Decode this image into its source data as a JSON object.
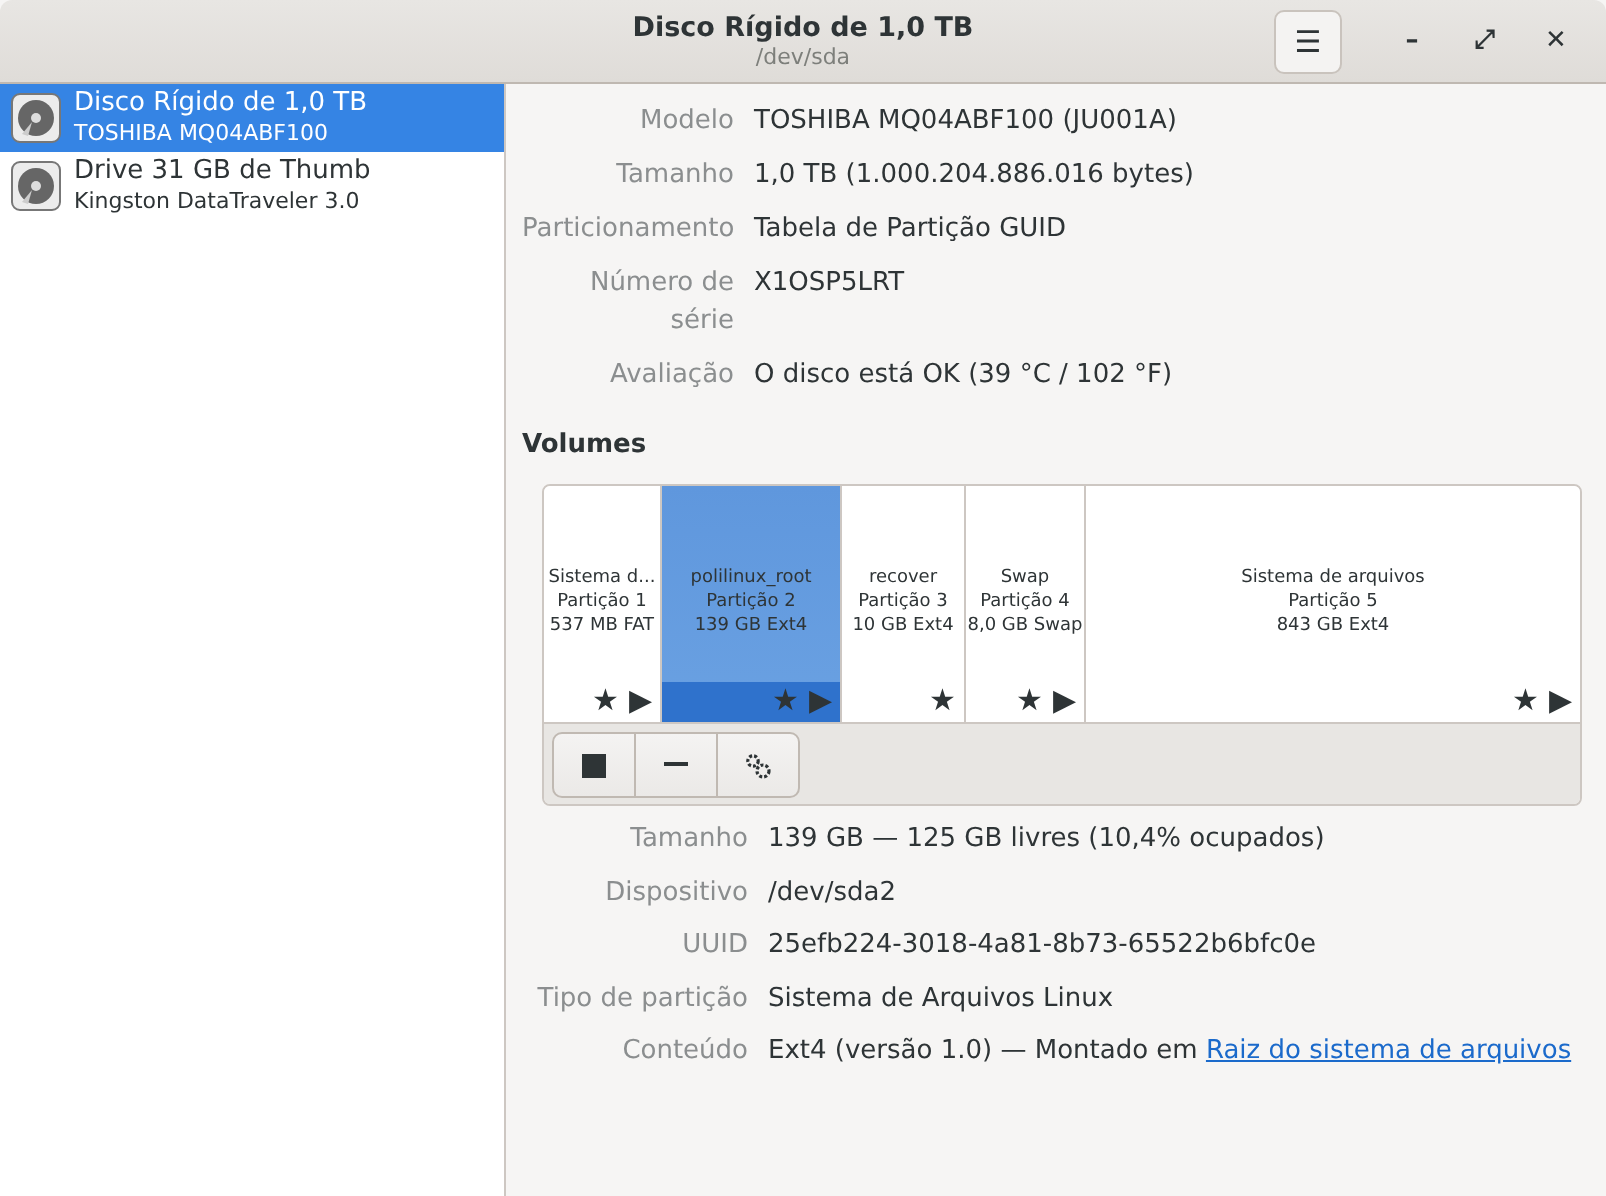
{
  "window": {
    "title": "Disco Rígido de 1,0 TB",
    "subtitle": "/dev/sda",
    "menu_button": "☰",
    "minimize": "–",
    "maximize": "⤢",
    "close": "✕"
  },
  "sidebar": {
    "items": [
      {
        "name": "Disco Rígido de 1,0 TB",
        "detail": "TOSHIBA MQ04ABF100",
        "selected": true
      },
      {
        "name": "Drive 31 GB de Thumb",
        "detail": "Kingston DataTraveler 3.0",
        "selected": false
      }
    ]
  },
  "drive_info": [
    {
      "label": "Modelo",
      "value": "TOSHIBA MQ04ABF100 (JU001A)"
    },
    {
      "label": "Tamanho",
      "value": "1,0 TB (1.000.204.886.016 bytes)"
    },
    {
      "label": "Particionamento",
      "value": "Tabela de Partição GUID"
    },
    {
      "label": "Número de série",
      "value": "X1OSP5LRT"
    },
    {
      "label": "Avaliação",
      "value": "O disco está OK (39 °C / 102 °F)"
    }
  ],
  "volumes": {
    "heading": "Volumes",
    "partitions": [
      {
        "name": "Sistema d...",
        "number": "Partição 1",
        "size": "537 MB FAT",
        "marks": [
          "★",
          "▶"
        ],
        "selected": false
      },
      {
        "name": "polilinux_root",
        "number": "Partição 2",
        "size": "139 GB Ext4",
        "marks": [
          "★",
          "▶"
        ],
        "selected": true
      },
      {
        "name": "recover",
        "number": "Partição 3",
        "size": "10 GB Ext4",
        "marks": [
          "★"
        ],
        "selected": false
      },
      {
        "name": "Swap",
        "number": "Partição 4",
        "size": "8,0 GB Swap",
        "marks": [
          "★",
          "▶"
        ],
        "selected": false
      },
      {
        "name": "Sistema de arquivos",
        "number": "Partição 5",
        "size": "843 GB Ext4",
        "marks": [
          "★",
          "▶"
        ],
        "selected": false
      }
    ],
    "toolbar": [
      {
        "kind": "stop"
      },
      {
        "kind": "remove"
      },
      {
        "kind": "settings"
      }
    ]
  },
  "volume_info": [
    {
      "label": "Tamanho",
      "value": "139 GB — 125 GB livres (10,4% ocupados)"
    },
    {
      "label": "Dispositivo",
      "value": "/dev/sda2"
    },
    {
      "label": "UUID",
      "value": "25efb224-3018-4a81-8b73-65522b6bfc0e"
    },
    {
      "label": "Tipo de partição",
      "value": "Sistema de Arquivos Linux"
    },
    {
      "label": "Conteúdo",
      "value": "Ext4 (versão 1.0) — Montado em ",
      "link": "Raiz do sistema de arquivos"
    }
  ]
}
